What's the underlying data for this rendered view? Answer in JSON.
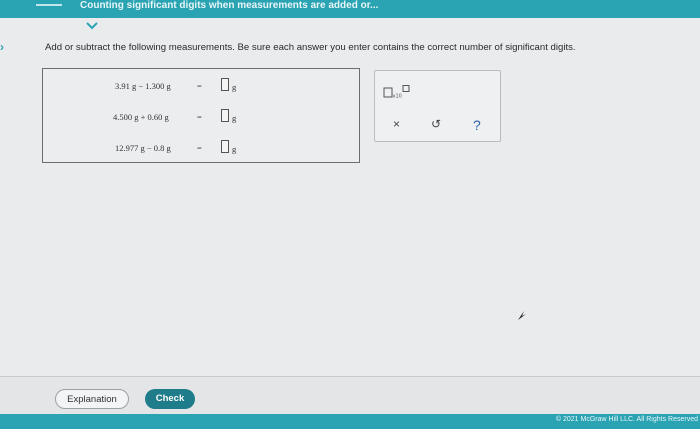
{
  "header": {
    "title": "Counting significant digits when measurements are added or..."
  },
  "instructions": "Add or subtract the following measurements. Be sure each answer you enter contains the correct number of significant digits.",
  "problems": [
    {
      "expression": "3.91 g − 1.300 g",
      "equals": "=",
      "unit": "g"
    },
    {
      "expression": "4.500 g + 0.60 g",
      "equals": "=",
      "unit": "g"
    },
    {
      "expression": "12.977 g − 0.8 g",
      "equals": "=",
      "unit": "g"
    }
  ],
  "tools": {
    "scientific_notation_icon": "x10-superscript-icon",
    "clear_symbol": "×",
    "undo_symbol": "↺",
    "help_symbol": "?"
  },
  "footer": {
    "explanation_label": "Explanation",
    "check_label": "Check",
    "copyright": "© 2021 McGraw Hill LLC. All Rights Reserved"
  },
  "colors": {
    "accent": "#2aa3b3",
    "check_button": "#1f7c8a"
  }
}
